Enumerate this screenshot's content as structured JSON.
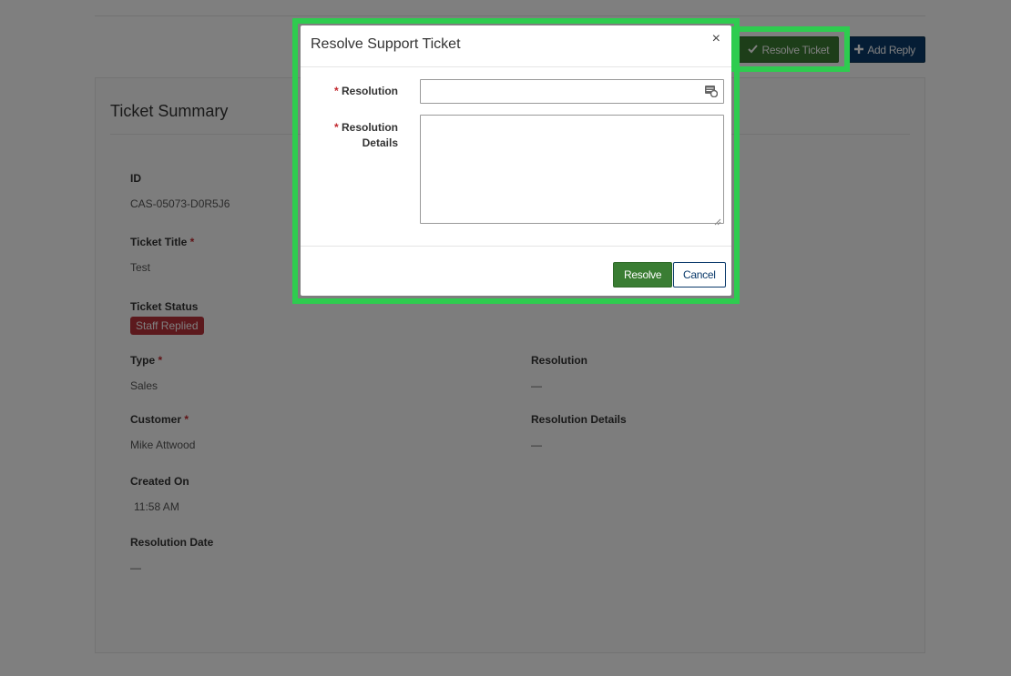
{
  "header": {
    "resolve_ticket_label": "Resolve Ticket",
    "add_reply_label": "Add Reply"
  },
  "card": {
    "title": "Ticket Summary",
    "fields": {
      "id": {
        "label": "ID",
        "value": "CAS-05073-D0R5J6"
      },
      "ticket_title": {
        "label": "Ticket Title",
        "required": "*",
        "value": "Test"
      },
      "ticket_status": {
        "label": "Ticket Status",
        "value": "Staff Replied"
      },
      "type": {
        "label": "Type",
        "required": "*",
        "value": "Sales"
      },
      "customer": {
        "label": "Customer",
        "required": "*",
        "value": "Mike Attwood"
      },
      "created_on": {
        "label": "Created On",
        "value": "11:58 AM"
      },
      "resolution_date": {
        "label": "Resolution Date",
        "value": "—"
      },
      "resolution": {
        "label": "Resolution",
        "value": "—"
      },
      "resolution_details": {
        "label": "Resolution Details",
        "value": "—"
      }
    }
  },
  "modal": {
    "title": "Resolve Support Ticket",
    "close_symbol": "×",
    "resolution_label": "Resolution",
    "resolution_details_label_line1": "Resolution",
    "resolution_details_label_line2": "Details",
    "required": "*",
    "resolution_value": "",
    "resolution_details_value": "",
    "resolve_button": "Resolve",
    "cancel_button": "Cancel"
  },
  "colors": {
    "accent_green": "#3a7d33",
    "accent_navy": "#0a3a6b",
    "status_badge": "#b8323b",
    "highlight": "#2ecc4f"
  },
  "icons": {
    "resolve_ticket": "check-icon",
    "add_reply": "plus-icon",
    "resolution_lookup": "lookup-icon"
  }
}
